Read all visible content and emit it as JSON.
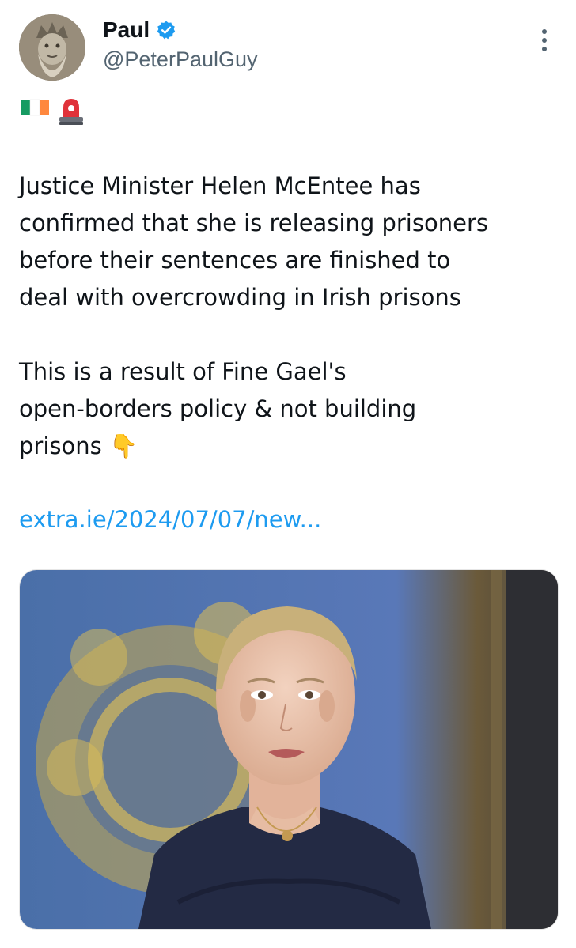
{
  "tweet": {
    "display_name": "Paul",
    "handle": "@PeterPaulGuy",
    "verified": true,
    "header_emojis": [
      "flag-ireland",
      "rotating-light"
    ],
    "text": "Justice Minister Helen McEntee has\nconfirmed that she is releasing prisoners\nbefore their sentences are finished to\ndeal with overcrowding in Irish prisons\n\nThis is a result of Fine Gael's\nopen-borders policy & not building\nprisons 👇",
    "link_text": "extra.ie/2024/07/07/new...",
    "media_description_icon": "photo"
  },
  "colors": {
    "link": "#1d9bf0",
    "verified_badge": "#1d9bf0",
    "secondary_text": "#536471"
  }
}
